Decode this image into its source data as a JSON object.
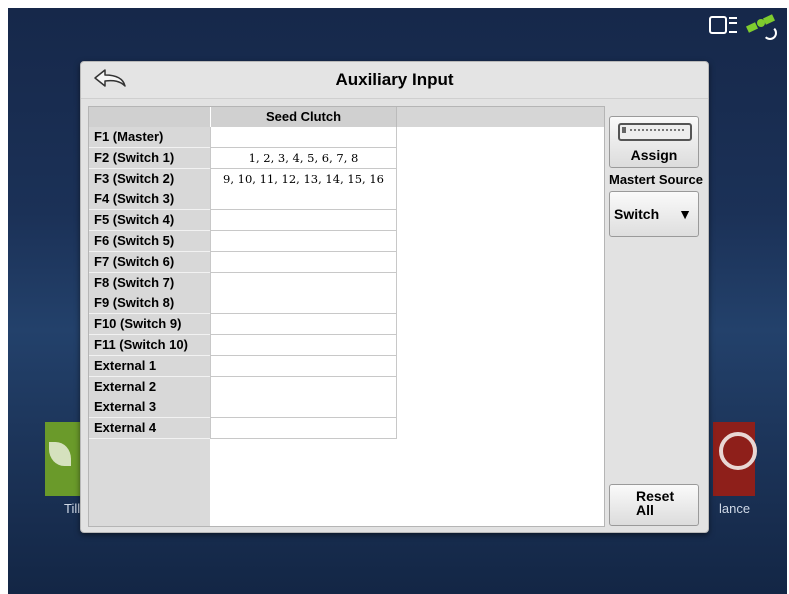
{
  "background": {
    "tiles": {
      "left_label": "Tilla",
      "right_label": "lance"
    }
  },
  "status_icons": [
    "display-icon",
    "satellite-icon"
  ],
  "dialog": {
    "title": "Auxiliary Input",
    "table": {
      "column_header": "Seed Clutch",
      "rows": [
        {
          "label": "F1 (Master)",
          "value": ""
        },
        {
          "label": "F2 (Switch 1)",
          "value": "1, 2, 3, 4, 5, 6, 7, 8"
        },
        {
          "label": "F3 (Switch 2)",
          "value": "9, 10, 11, 12, 13, 14, 15, 16"
        },
        {
          "label": "F4 (Switch 3)",
          "value": ""
        },
        {
          "label": "F5 (Switch 4)",
          "value": ""
        },
        {
          "label": "F6 (Switch 5)",
          "value": ""
        },
        {
          "label": "F7 (Switch 6)",
          "value": ""
        },
        {
          "label": "F8 (Switch 7)",
          "value": ""
        },
        {
          "label": "F9 (Switch 8)",
          "value": ""
        },
        {
          "label": "F10 (Switch 9)",
          "value": ""
        },
        {
          "label": "F11 (Switch 10)",
          "value": ""
        },
        {
          "label": "External 1",
          "value": ""
        },
        {
          "label": "External 2",
          "value": ""
        },
        {
          "label": "External 3",
          "value": ""
        },
        {
          "label": "External 4",
          "value": ""
        }
      ]
    },
    "side": {
      "assign_label": "Assign",
      "source_label": "Mastert Source",
      "source_value": "Switch",
      "reset_label": "Reset\nAll"
    }
  },
  "colors": {
    "accent_green": "#7fcc2e",
    "tile_green": "#6a9a2a",
    "tile_red": "#8e1f1a"
  }
}
